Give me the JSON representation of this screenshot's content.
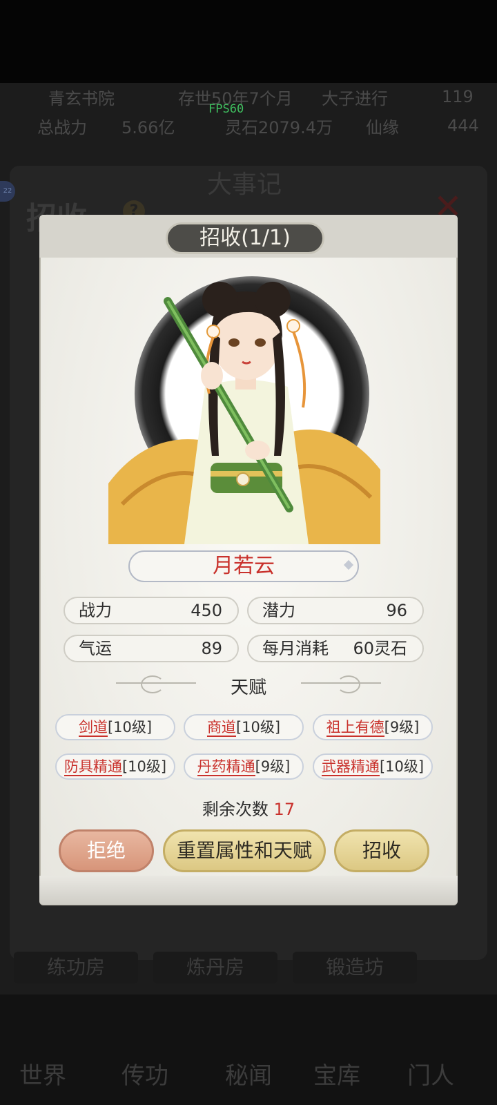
{
  "background": {
    "top_stats": {
      "row1": [
        "青玄书院",
        "存世50年7个月",
        "大子进行",
        "119"
      ],
      "row2": [
        "总战力",
        "5.66亿",
        "灵石2079.4万",
        "仙缘",
        "444"
      ]
    },
    "fps": "FPS60",
    "screen_title": "大事记",
    "section_title": "招收",
    "help_icon": "?",
    "badge": "22",
    "rooms": [
      "练功房",
      "炼丹房",
      "锻造坊"
    ],
    "nav": [
      "世界",
      "传功",
      "秘闻",
      "宝库",
      "门人"
    ]
  },
  "modal": {
    "title": "招收(1/1)",
    "disciple_name": "月若云",
    "stats": [
      {
        "label": "战力",
        "value": "450"
      },
      {
        "label": "潜力",
        "value": "96"
      },
      {
        "label": "气运",
        "value": "89"
      },
      {
        "label": "每月消耗",
        "value": "60灵石"
      }
    ],
    "talent_header": "天赋",
    "talents": [
      {
        "name": "剑道",
        "level": "[10级]"
      },
      {
        "name": "商道",
        "level": "[10级]"
      },
      {
        "name": "祖上有德",
        "level": "[9级]"
      },
      {
        "name": "防具精通",
        "level": "[10级]"
      },
      {
        "name": "丹药精通",
        "level": "[9级]"
      },
      {
        "name": "武器精通",
        "level": "[10级]"
      }
    ],
    "remaining_label": "剩余次数",
    "remaining_count": "17",
    "buttons": {
      "reject": "拒绝",
      "reset": "重置属性和天赋",
      "recruit": "招收"
    }
  },
  "colors": {
    "accent_red": "#c9312c",
    "title_bg": "#4d4c48",
    "button_gold": "#dcc883",
    "button_salmon": "#d7957a"
  }
}
